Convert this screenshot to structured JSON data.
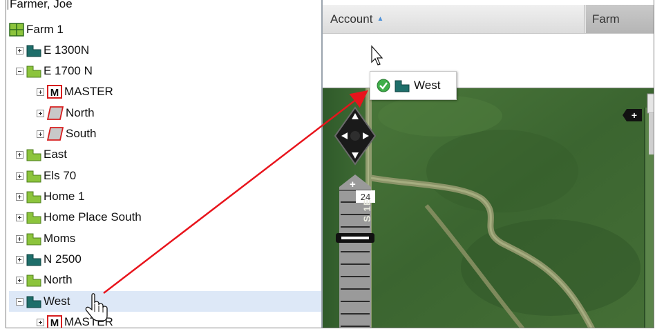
{
  "tree": {
    "account_label": "Farmer, Joe",
    "items": [
      {
        "label": "Farm 1"
      },
      {
        "label": "E 1300N"
      },
      {
        "label": "E 1700 N"
      },
      {
        "label": "MASTER"
      },
      {
        "label": "North"
      },
      {
        "label": "South"
      },
      {
        "label": "East"
      },
      {
        "label": "Els 70"
      },
      {
        "label": "Home 1"
      },
      {
        "label": "Home Place South"
      },
      {
        "label": "Moms"
      },
      {
        "label": "N 2500"
      },
      {
        "label": "North"
      },
      {
        "label": "West"
      },
      {
        "label": "MASTER"
      }
    ]
  },
  "grid": {
    "columns": [
      {
        "label": "Account",
        "sort": "ascending"
      },
      {
        "label": "Farm"
      }
    ]
  },
  "drag": {
    "label": "West",
    "status": "valid-drop"
  },
  "map": {
    "zoom_badge": "24",
    "road_label": "S 1E",
    "pan_icon": "pan-control-icon",
    "zoom_in_icon": "plus-icon"
  },
  "colors": {
    "selected_row": "#dde8f7",
    "field_teal": "#1e6e6a",
    "field_green": "#8cc43c",
    "master_red": "#d71e1e",
    "arrow_red": "#e8141c",
    "sort_arrow": "#4a90d9",
    "check_green": "#3fae49"
  }
}
